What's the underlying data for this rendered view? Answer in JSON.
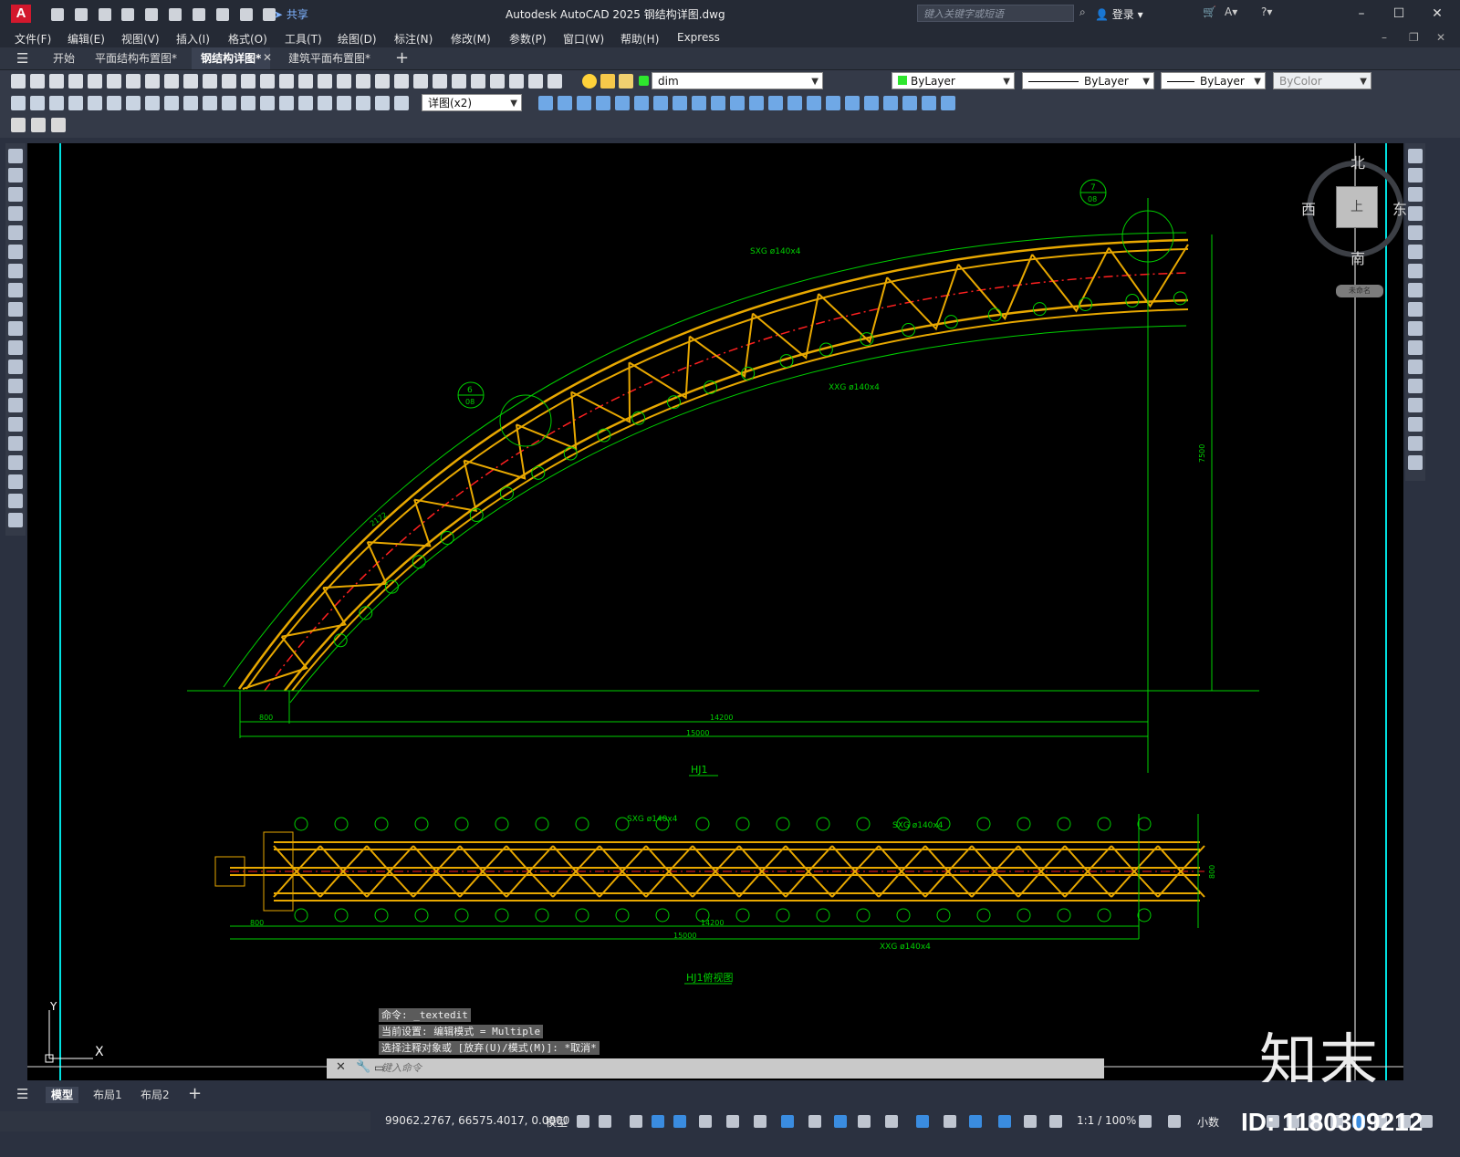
{
  "titlebar": {
    "logo": "A",
    "share": "共享",
    "title": "Autodesk AutoCAD 2025    钢结构详图.dwg",
    "search_placeholder": "键入关键字或短语",
    "login": "登录"
  },
  "menu": [
    "文件(F)",
    "编辑(E)",
    "视图(V)",
    "插入(I)",
    "格式(O)",
    "工具(T)",
    "绘图(D)",
    "标注(N)",
    "修改(M)",
    "参数(P)",
    "窗口(W)",
    "帮助(H)",
    "Express"
  ],
  "tabs": [
    "开始",
    "平面结构布置图*",
    "钢结构详图*",
    "建筑平面布置图*"
  ],
  "toolbar": {
    "layer": "dim",
    "color": "ByLayer",
    "linetype": "ByLayer",
    "lineweight": "ByLayer",
    "plotstyle": "ByColor",
    "dimstyle": "详图(x2)"
  },
  "viewcube": {
    "north": "北",
    "south": "南",
    "east": "东",
    "west": "西",
    "top": "上",
    "wcs": "未命名"
  },
  "drawing": {
    "top_view_title": "HJ1",
    "bottom_view_title": "HJ1俯视图",
    "member_top": "SXG ø140x4",
    "member_bottom": "XXG ø140x4",
    "dims": {
      "d800": "800",
      "d14200": "14200",
      "d15000": "15000",
      "d7500": "7500",
      "seg": "2172"
    },
    "callout_6": "6",
    "callout_6_sheet": "08",
    "callout_7": "7",
    "callout_7_sheet": "08",
    "ucs_y": "Y",
    "ucs_x": "X"
  },
  "command": {
    "line1": "命令: _textedit",
    "line2": "当前设置: 编辑模式 = Multiple",
    "line3": "选择注释对象或 [放弃(U)/模式(M)]: *取消*",
    "placeholder": "键入命令"
  },
  "layout_tabs": [
    "模型",
    "布局1",
    "布局2"
  ],
  "status": {
    "coords": "99062.2767, 66575.4017, 0.0000",
    "model": "模型",
    "scale": "1:1 / 100%",
    "units": "小数"
  },
  "watermark": {
    "brand": "知末",
    "id": "ID: 1180309212"
  }
}
